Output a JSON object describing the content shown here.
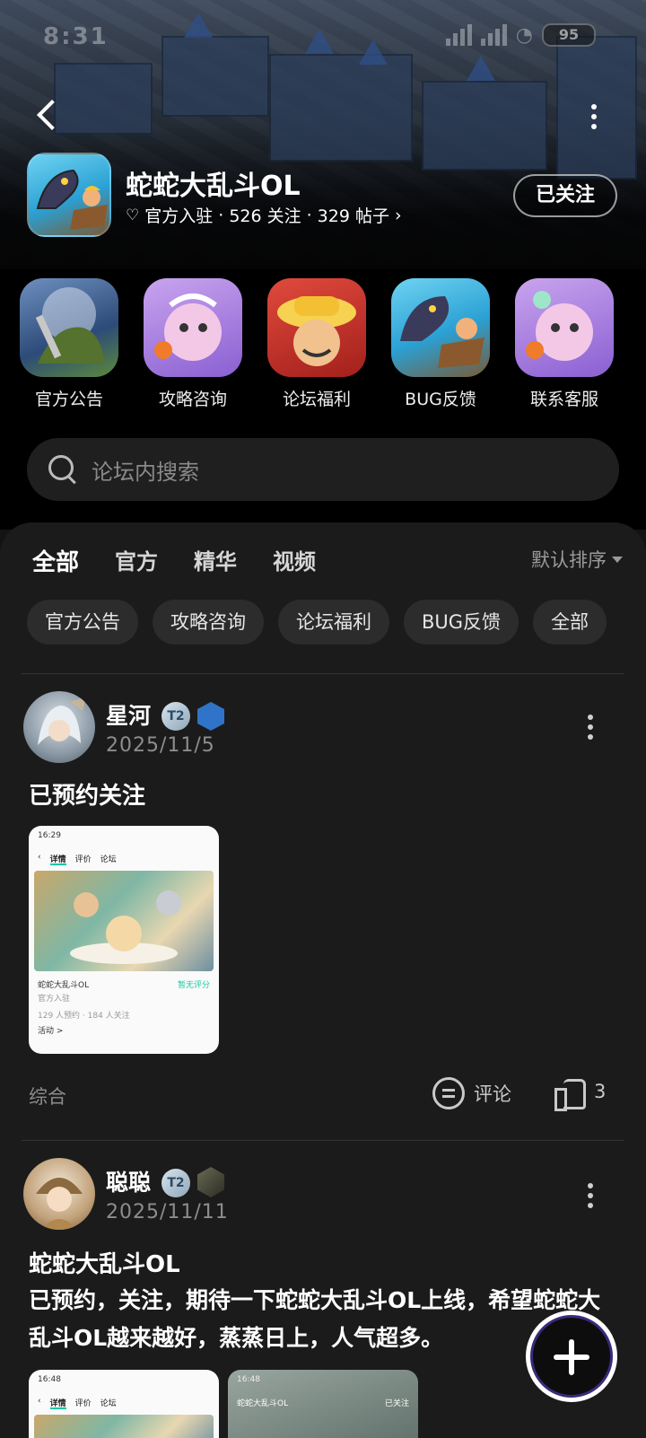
{
  "status_bar": {
    "time": "8:31",
    "battery": "95"
  },
  "header": {
    "game_name": "蛇蛇大乱斗OL",
    "official_label": "官方入驻",
    "followers": "526 关注",
    "posts": "329 帖子",
    "follow_button": "已关注"
  },
  "shortcuts": [
    {
      "label": "官方公告",
      "icon": "announcement-art"
    },
    {
      "label": "攻略咨询",
      "icon": "guide-art"
    },
    {
      "label": "论坛福利",
      "icon": "welfare-art"
    },
    {
      "label": "BUG反馈",
      "icon": "bug-report-art"
    },
    {
      "label": "联系客服",
      "icon": "customer-service-art"
    }
  ],
  "search": {
    "placeholder": "论坛内搜索"
  },
  "tabs": [
    {
      "label": "全部",
      "active": true
    },
    {
      "label": "官方"
    },
    {
      "label": "精华"
    },
    {
      "label": "视频"
    }
  ],
  "sort_label": "默认排序",
  "chips": [
    "官方公告",
    "攻略咨询",
    "论坛福利",
    "BUG反馈",
    "全部"
  ],
  "posts": [
    {
      "author": "星河",
      "level": "2",
      "date": "2025/11/5",
      "title": "已预约关注",
      "category": "综合",
      "comment_label": "评论",
      "likes": "3",
      "screenshot": {
        "time": "16:29",
        "tab_detail": "详情",
        "tab_review": "评价",
        "tab_forum": "论坛",
        "game": "蛇蛇大乱斗OL",
        "rating_hint": "暂无评分",
        "official": "官方入驻",
        "stats": "129 人预约 · 184 人关注",
        "activity": "活动 >"
      }
    },
    {
      "author": "聪聪",
      "level": "2",
      "date": "2025/11/11",
      "title": "蛇蛇大乱斗OL",
      "body": "已预约，关注，期待一下蛇蛇大乱斗OL上线，希望蛇蛇大乱斗OL越来越好，蒸蒸日上，人气超多。",
      "screenshot_a": {
        "time": "16:48",
        "tab_detail": "详情",
        "tab_review": "评价",
        "tab_forum": "论坛"
      },
      "screenshot_b": {
        "time": "16:48",
        "game": "蛇蛇大乱斗OL",
        "follow": "已关注"
      }
    }
  ],
  "colors": {
    "accent": "#14c9a6",
    "background": "#1b1b1b",
    "header_bg": "#000000"
  }
}
